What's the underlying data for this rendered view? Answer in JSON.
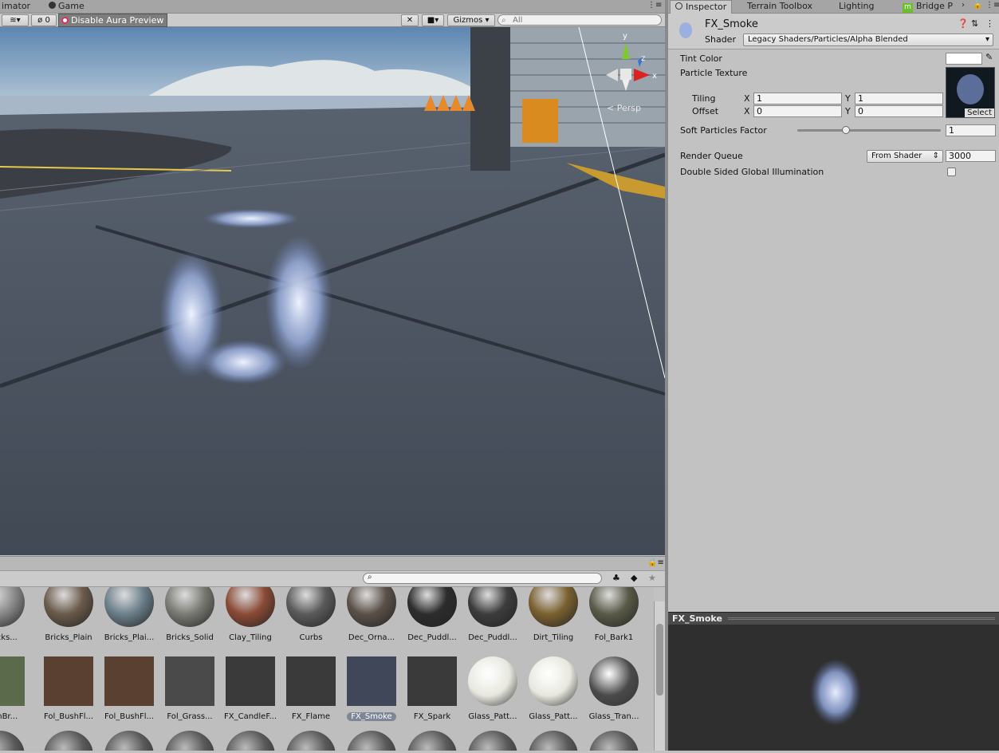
{
  "left_tabs": {
    "animator": "imator",
    "game": "Game"
  },
  "scene_toolbar": {
    "hidden_count": "0",
    "aura_button": "Disable Aura Preview",
    "gizmos": "Gizmos",
    "search_placeholder": "All"
  },
  "scene": {
    "persp_label": "< Persp",
    "axis_x": "x",
    "axis_y": "y",
    "axis_z": "z"
  },
  "inspector_tabs": {
    "inspector": "Inspector",
    "terrain_toolbox": "Terrain Toolbox",
    "lighting": "Lighting",
    "bridge": "Bridge P"
  },
  "material": {
    "name": "FX_Smoke",
    "shader_label": "Shader",
    "shader_value": "Legacy Shaders/Particles/Alpha Blended"
  },
  "properties": {
    "tint_color": "Tint Color",
    "particle_texture": "Particle Texture",
    "tiling": "Tiling",
    "offset": "Offset",
    "x": "X",
    "y": "Y",
    "tiling_x": "1",
    "tiling_y": "1",
    "offset_x": "0",
    "offset_y": "0",
    "select": "Select",
    "soft_particles": "Soft Particles Factor",
    "soft_value": "1",
    "soft_slider_fraction": 0.33,
    "render_queue": "Render Queue",
    "render_queue_mode": "From Shader",
    "render_queue_value": "3000",
    "double_sided_gi": "Double Sided Global Illumination"
  },
  "preview": {
    "title": "FX_Smoke"
  },
  "project_items_row1": [
    "_Rocks...",
    "Bricks_Plain",
    "Bricks_Plai...",
    "Bricks_Solid",
    "Clay_Tiling",
    "Curbs",
    "Dec_Orna...",
    "Dec_Puddl...",
    "Dec_Puddl...",
    "Dirt_Tiling",
    "Fol_Bark1"
  ],
  "project_items_row2": [
    "BushBr...",
    "Fol_BushFl...",
    "Fol_BushFl...",
    "Fol_Grass...",
    "FX_CandleF...",
    "FX_Flame",
    "FX_Smoke",
    "FX_Spark",
    "Glass_Patt...",
    "Glass_Patt...",
    "Glass_Tran..."
  ],
  "colors": {
    "selection": "#7e8796",
    "scene_ground": "#4f5866"
  }
}
